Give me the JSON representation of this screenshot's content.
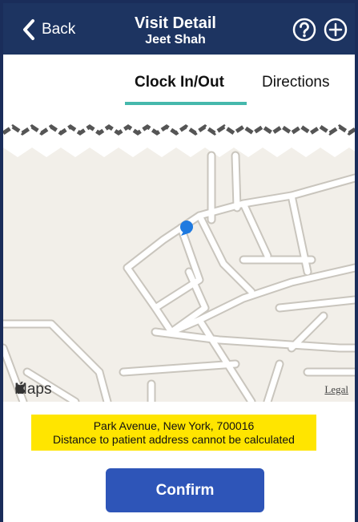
{
  "header": {
    "back_label": "Back",
    "title": "Visit Detail",
    "subtitle": "Jeet Shah",
    "help_icon": "question-circle-icon",
    "add_icon": "plus-circle-icon",
    "background_color": "#1d3461"
  },
  "tabs": [
    {
      "label": "Clock In/Out",
      "active": true
    },
    {
      "label": "Directions",
      "active": false
    }
  ],
  "tab_accent_color": "#45b8ac",
  "map": {
    "attribution": "Maps",
    "legal_label": "Legal",
    "location_pin_color": "#1f7ae0"
  },
  "address": {
    "line1": "Park Avenue, New York, 700016",
    "line2": "Distance to patient address cannot be calculated",
    "highlight_color": "#ffe500"
  },
  "confirm_label": "Confirm",
  "confirm_color": "#2e55b8"
}
